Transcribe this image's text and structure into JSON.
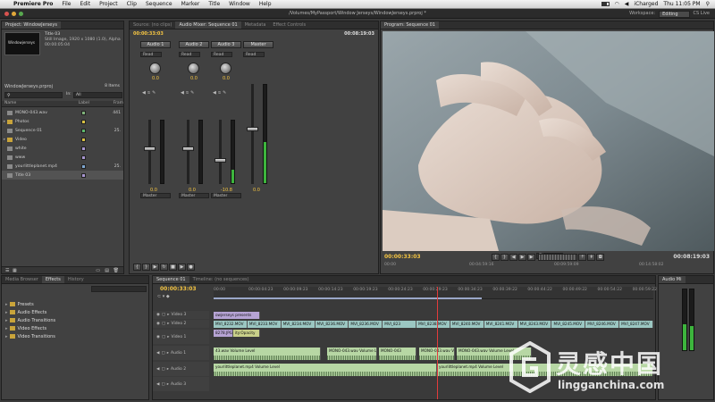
{
  "menubar": {
    "app": "Premiere Pro",
    "items": [
      "File",
      "Edit",
      "Project",
      "Clip",
      "Sequence",
      "Marker",
      "Title",
      "Window",
      "Help"
    ],
    "user": "iCharged",
    "clock": "Thu 11:05 PM"
  },
  "titlebar": {
    "path": "/Volumes/MyPassport/Window Jerseys/WindowJerseys.prproj *",
    "workspace_label": "Workspace:",
    "workspace_value": "Editing",
    "cslive": "CS Live"
  },
  "project": {
    "tab": "Project: WindowJerseys",
    "clip_name": "Title 03",
    "clip_info1": "Still Image, 1920 x 1080 (1.0), Alpha",
    "clip_info2": "00:00:05:04",
    "file": "WindowJerseys.prproj",
    "count": "8 Items",
    "in_label": "In:",
    "in_value": "All",
    "col_name": "Name",
    "col_label": "Label",
    "col_frame": "Fram",
    "items": [
      {
        "name": "MONO-043.wav",
        "frame": "441",
        "color": "#7fb27a",
        "folder": false,
        "sel": false
      },
      {
        "name": "Photos",
        "frame": "",
        "color": "#d8c043",
        "folder": true,
        "sel": false
      },
      {
        "name": "Sequence 01",
        "frame": "25.",
        "color": "#5db76b",
        "folder": false,
        "sel": false
      },
      {
        "name": "Video",
        "frame": "",
        "color": "#d8c043",
        "folder": true,
        "sel": false
      },
      {
        "name": "white",
        "frame": "",
        "color": "#a896d0",
        "folder": false,
        "sel": false
      },
      {
        "name": "www",
        "frame": "",
        "color": "#a896d0",
        "folder": false,
        "sel": false
      },
      {
        "name": "yourlittleplanet.mp4",
        "frame": "25.",
        "color": "#7fa7d0",
        "folder": false,
        "sel": false
      },
      {
        "name": "Title 03",
        "frame": "",
        "color": "#a896d0",
        "folder": false,
        "sel": true
      }
    ]
  },
  "mixer": {
    "tabs": [
      "Source: (no clips)",
      "Audio Mixer: Sequence 01",
      "Metadata",
      "Effect Controls"
    ],
    "tc_left": "00:00:33:03",
    "tc_right": "00:08:19:03",
    "read_label": "Read",
    "channels": [
      {
        "name": "Audio 1",
        "pan": "0.0",
        "vol": "0.0",
        "fader": 0.45,
        "meter": 0.0,
        "out": "Master"
      },
      {
        "name": "Audio 2",
        "pan": "0.0",
        "vol": "0.0",
        "fader": 0.45,
        "meter": 0.0,
        "out": "Master"
      },
      {
        "name": "Audio 3",
        "pan": "0.0",
        "vol": "-10.8",
        "fader": 0.62,
        "meter": 0.22,
        "out": "Master"
      },
      {
        "name": "Master",
        "pan": "",
        "vol": "0.0",
        "fader": 0.45,
        "meter": 0.42,
        "out": ""
      }
    ]
  },
  "program": {
    "tab": "Program: Sequence 01",
    "tc_left": "00:00:33:03",
    "tc_right": "00:08:19:03",
    "fit": "Fit",
    "ruler": [
      "00:00",
      "00:04:59:16",
      "00:09:59:09",
      "00:14:58:02"
    ]
  },
  "effects": {
    "tabs": [
      "Media Browser",
      "Effects",
      "History"
    ],
    "folders": [
      "Presets",
      "Audio Effects",
      "Audio Transitions",
      "Video Effects",
      "Video Transitions"
    ]
  },
  "timeline": {
    "tabs": [
      "Sequence 01",
      "Timeline: (no sequences)"
    ],
    "tc": "00:00:33:03",
    "ruler": [
      "00:00",
      "00:00:04:23",
      "00:00:09:23",
      "00:00:14:23",
      "00:00:19:23",
      "00:00:24:23",
      "00:00:29:23",
      "00:00:34:23",
      "00:00:39:22",
      "00:00:44:22",
      "00:00:49:22",
      "00:00:54:22",
      "00:00:59:22"
    ],
    "tracks": [
      "Video 3",
      "Video 2",
      "Video 1",
      "Audio 1",
      "Audio 2",
      "Audio 3"
    ],
    "v3_clips": [
      "owjerseys presents"
    ],
    "v2_clips": [
      "MVI_8232.MOV",
      "MVI_8233.MOV",
      "MVI_8234.MOV",
      "MVI_8236.MOV",
      "MVI_8236.MOV",
      "MVI_823",
      "MVI_8238.MOV",
      "MVI_8240.MOV",
      "MVI_8241.MOV",
      "MVI_8243.MOV",
      "MVI_8245.MOV",
      "MVI_8246.MOV",
      "MVI_8247.MOV"
    ],
    "v1_clip": "8278.JPG",
    "v1_tag": "ity:Opacity",
    "a1_clips": [
      "43.wav Volume Level",
      "MONO-043.wav Volume Level",
      "MONO-043",
      "MONO-043.wav Volume Level",
      "MONO-043.wav Volume Level"
    ],
    "a2_clips": [
      "yourlittleplanet.mp4 Volume Level",
      "yourlittleplanet.mp4 Volume Level"
    ]
  },
  "audio_meter": {
    "tab": "Audio Mi"
  },
  "watermark": {
    "cn": "灵感中国",
    "url": "lingganchina.com"
  }
}
